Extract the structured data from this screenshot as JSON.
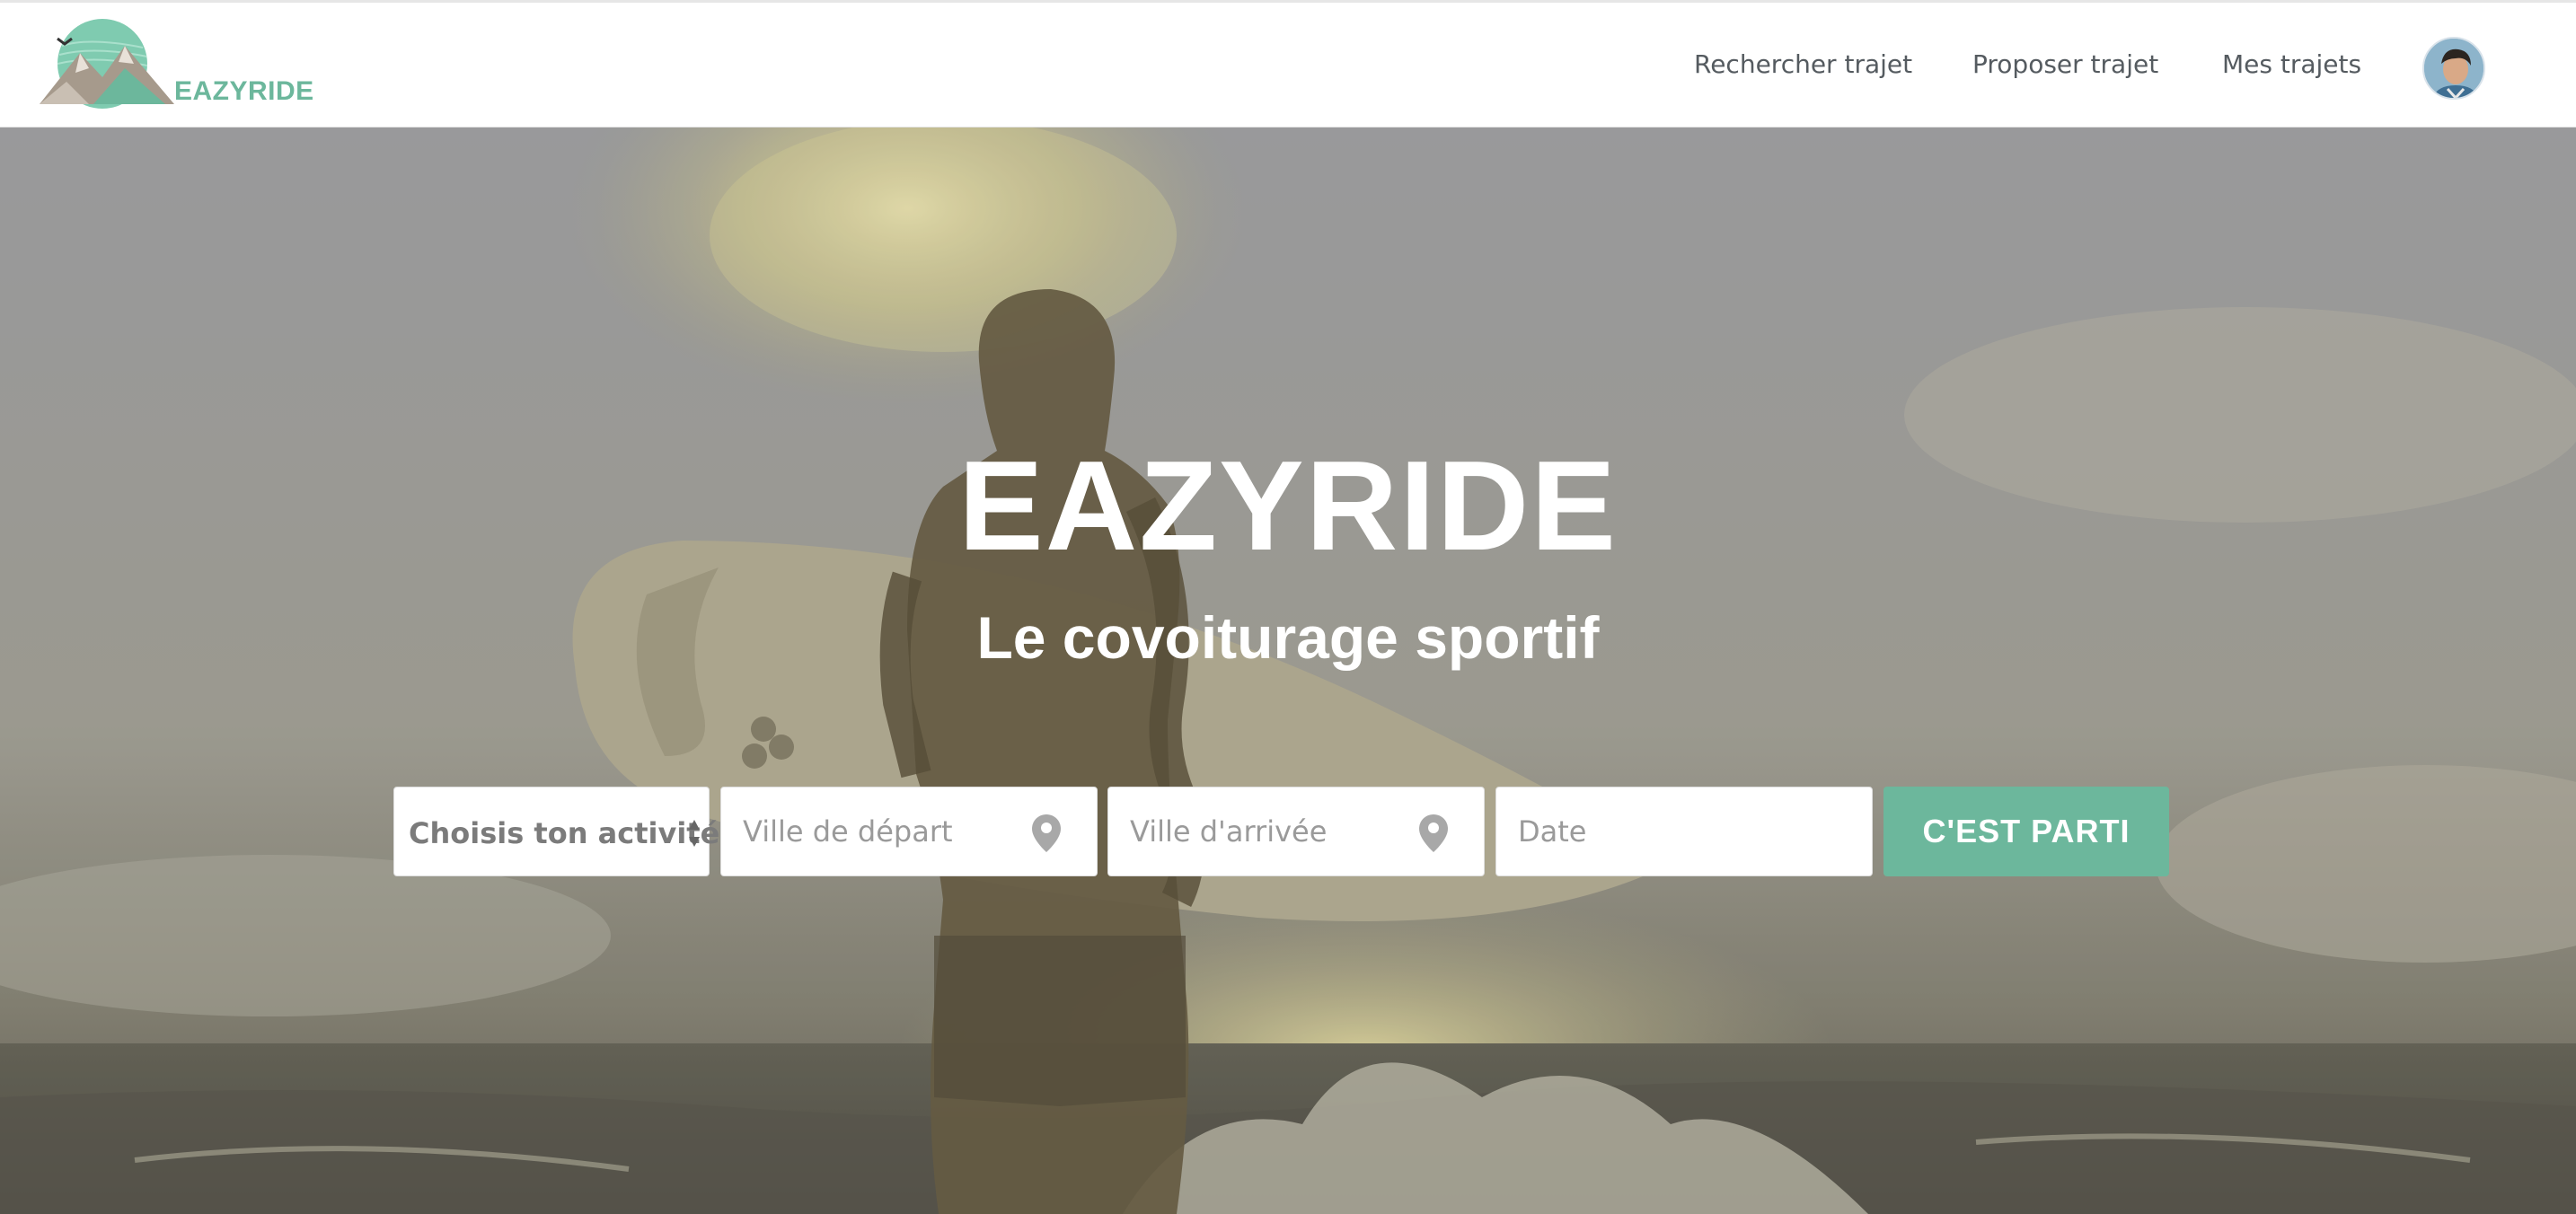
{
  "brand": {
    "name": "EAZYRIDE",
    "logo_icon": "mountain-bird-logo",
    "accent_color": "#6cb79c"
  },
  "nav": {
    "links": [
      {
        "label": "Rechercher trajet"
      },
      {
        "label": "Proposer trajet"
      },
      {
        "label": "Mes trajets"
      }
    ],
    "avatar_icon": "user-avatar"
  },
  "hero": {
    "title": "EAZYRIDE",
    "subtitle": "Le covoiturage sportif",
    "background": "surfer-silhouette-photo"
  },
  "search": {
    "activity_select": "Choisis ton activité",
    "departure_placeholder": "Ville de départ",
    "arrival_placeholder": "Ville d'arrivée",
    "date_placeholder": "Date",
    "submit_label": "C'EST PARTI",
    "pin_icon": "map-pin-icon"
  }
}
